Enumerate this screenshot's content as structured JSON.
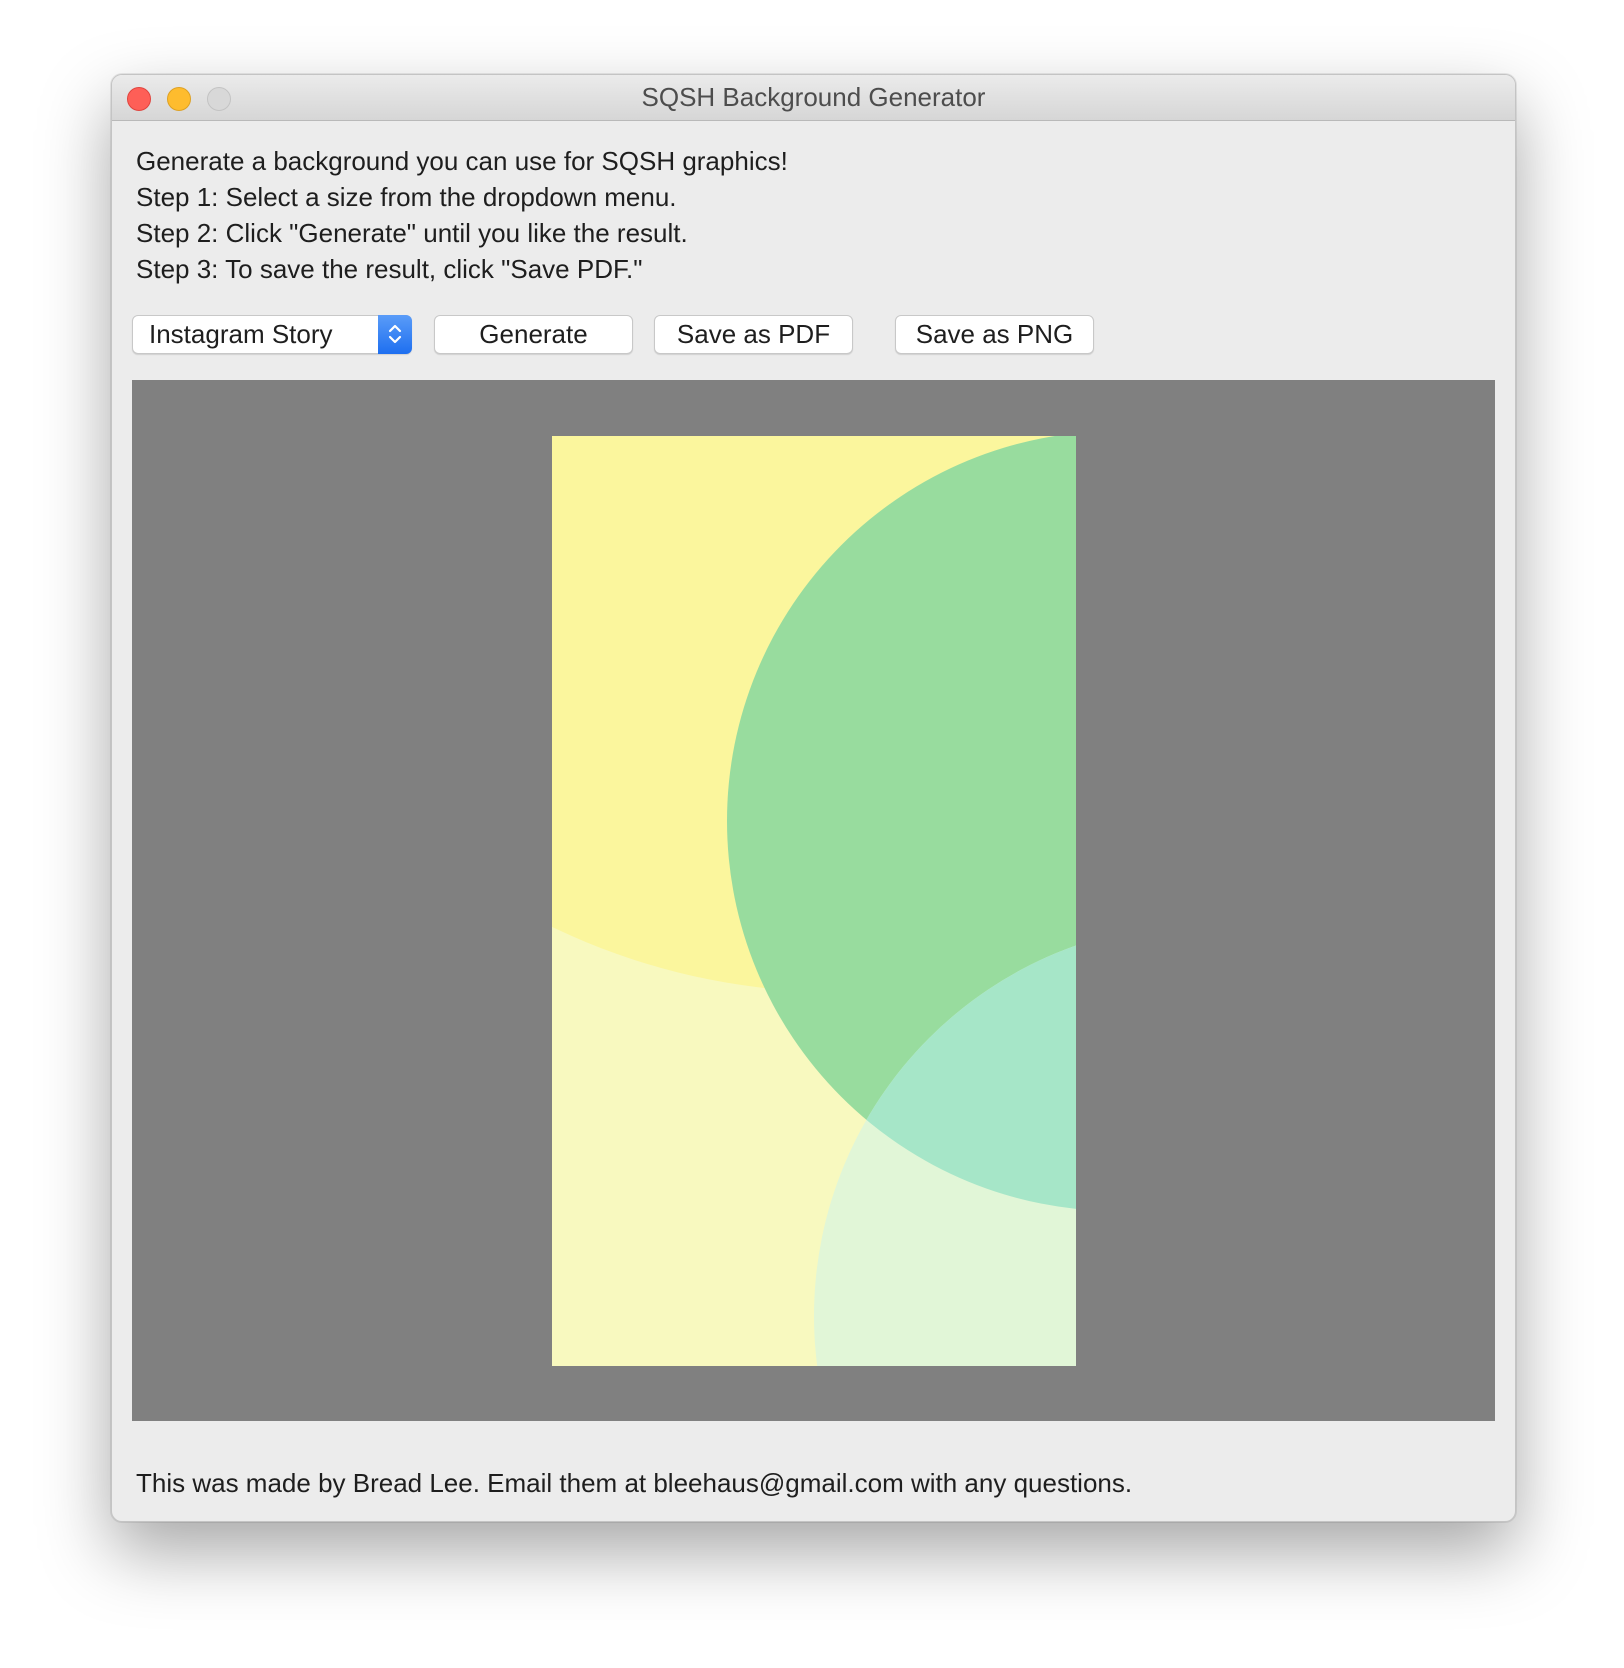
{
  "window": {
    "title": "SQSH Background Generator"
  },
  "instructions": [
    "Generate a background you can use for SQSH graphics!",
    "Step 1: Select a size from the dropdown menu.",
    "Step 2: Click \"Generate\" until you like the result.",
    "Step 3: To save the result, click \"Save PDF.\""
  ],
  "controls": {
    "size_select": {
      "selected": "Instagram Story"
    },
    "generate_label": "Generate",
    "save_pdf_label": "Save as PDF",
    "save_png_label": "Save as PNG"
  },
  "preview": {
    "canvas_color": "#808080",
    "colors": [
      "#f8f9bf",
      "#fbf69d",
      "#98dc9e",
      "#a6e6c8",
      "#e1f6d7"
    ]
  },
  "footer": {
    "text": "This was made by Bread Lee. Email them at bleehaus@gmail.com with any questions."
  }
}
